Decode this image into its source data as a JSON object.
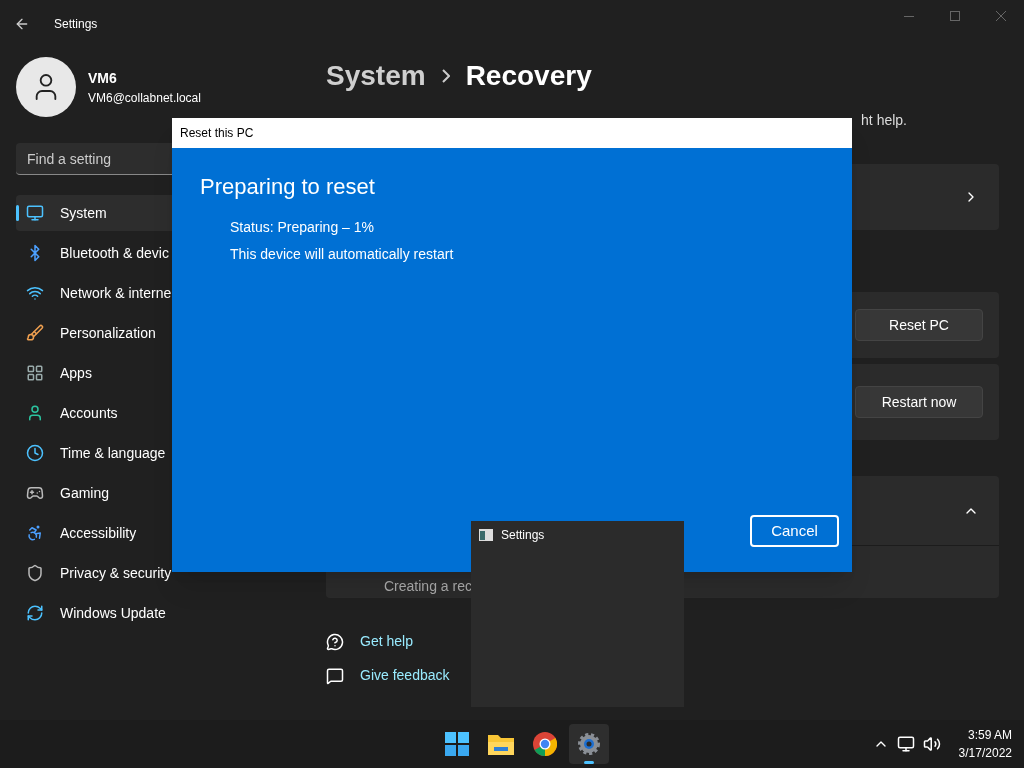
{
  "settings_window": {
    "title": "Settings",
    "user": {
      "name": "VM6",
      "email": "VM6@collabnet.local"
    },
    "search": {
      "placeholder": "Find a setting"
    },
    "nav": [
      {
        "label": "System",
        "kind": "system",
        "selected": true
      },
      {
        "label": "Bluetooth & devic",
        "kind": "bluetooth",
        "selected": false
      },
      {
        "label": "Network & interne",
        "kind": "network",
        "selected": false
      },
      {
        "label": "Personalization",
        "kind": "personalization",
        "selected": false
      },
      {
        "label": "Apps",
        "kind": "apps",
        "selected": false
      },
      {
        "label": "Accounts",
        "kind": "accounts",
        "selected": false
      },
      {
        "label": "Time & language",
        "kind": "time",
        "selected": false
      },
      {
        "label": "Gaming",
        "kind": "gaming",
        "selected": false
      },
      {
        "label": "Accessibility",
        "kind": "accessibility",
        "selected": false
      },
      {
        "label": "Privacy & security",
        "kind": "privacy",
        "selected": false
      },
      {
        "label": "Windows Update",
        "kind": "update",
        "selected": false
      }
    ],
    "breadcrumb": {
      "parent": "System",
      "current": "Recovery"
    },
    "intro_fragment": "ht help.",
    "buttons": [
      "Reset PC",
      "Restart now"
    ],
    "recovery_row_fragment": "Creating a rec",
    "links": [
      "Get help",
      "Give feedback"
    ]
  },
  "dialog": {
    "title": "Reset this PC",
    "heading": "Preparing to reset",
    "lines": [
      "Status: Preparing – 1%",
      "This device will automatically restart"
    ],
    "cancel": "Cancel"
  },
  "taskbar_preview": {
    "title": "Settings"
  },
  "taskbar": {
    "apps": [
      {
        "kind": "start",
        "selected": false
      },
      {
        "kind": "explorer",
        "selected": false
      },
      {
        "kind": "chrome",
        "selected": false
      },
      {
        "kind": "settings",
        "selected": true
      }
    ],
    "time": "3:59 AM",
    "date": "3/17/2022"
  }
}
